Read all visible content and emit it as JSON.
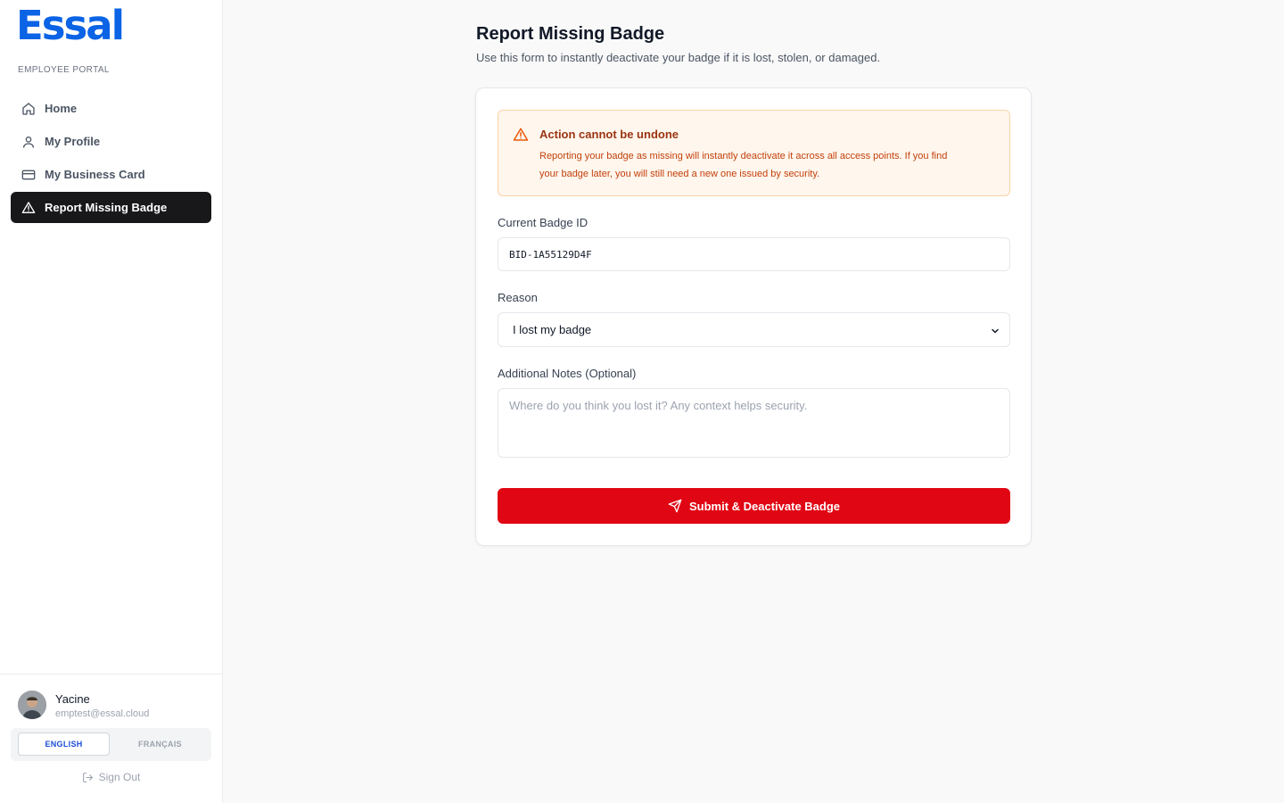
{
  "brand": {
    "logo": "Essal",
    "portal_label": "EMPLOYEE PORTAL",
    "accent": "#0b63e5"
  },
  "sidebar": {
    "items": [
      {
        "label": "Home",
        "icon": "home-icon"
      },
      {
        "label": "My Profile",
        "icon": "user-icon"
      },
      {
        "label": "My Business Card",
        "icon": "card-icon"
      },
      {
        "label": "Report Missing Badge",
        "icon": "warning-icon",
        "active": true
      }
    ]
  },
  "user": {
    "name": "Yacine",
    "email": "emptest@essal.cloud"
  },
  "language": {
    "english": "ENGLISH",
    "french": "FRANÇAIS",
    "selected": "ENGLISH"
  },
  "signout": {
    "label": "Sign Out"
  },
  "page": {
    "title": "Report Missing Badge",
    "subtitle": "Use this form to instantly deactivate your badge if it is lost, stolen, or damaged."
  },
  "alert": {
    "title": "Action cannot be undone",
    "line1": "Reporting your badge as missing will instantly deactivate it across all access points. If you find",
    "line2": "your badge later, you will still need a new one issued by security."
  },
  "form": {
    "badge_label": "Current Badge ID",
    "badge_value": "BID-1A55129D4F",
    "reason_label": "Reason",
    "reason_value": "I lost my badge",
    "notes_label": "Additional Notes (Optional)",
    "notes_placeholder": "Where do you think you lost it? Any context helps security.",
    "submit_label": "Submit & Deactivate Badge",
    "submit_color": "#e10613"
  }
}
